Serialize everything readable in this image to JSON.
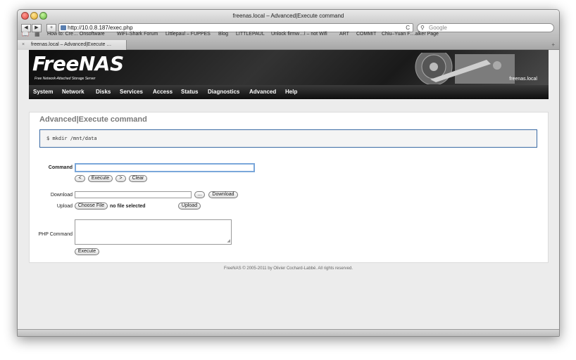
{
  "window": {
    "title": "freenas.local – Advanced|Execute command"
  },
  "toolbar": {
    "back": "◀",
    "forward": "▶",
    "add": "+",
    "url": "http://10.0.8.187/exec.php",
    "reload": "C",
    "search_placeholder": "Google"
  },
  "bookmarks": [
    "How to: Cre… Onsoftware",
    "WiFi–Shark Forum",
    "Littlepaul – FUPPES",
    "Blog",
    "LITTLEPAUL",
    "Unlock firmw…i – not Wifi",
    "ART",
    "COMMIT",
    "Chiu–Yuan F…alker Page"
  ],
  "tab": {
    "label": "freenas.local – Advanced|Execute …",
    "close": "×",
    "add": "+"
  },
  "header": {
    "logo": "FreeNAS",
    "tagline": "Free Network-Attached Storage Server",
    "hostname": "freenas.local"
  },
  "nav": [
    "System",
    "Network",
    "Disks",
    "Services",
    "Access",
    "Status",
    "Diagnostics",
    "Advanced",
    "Help"
  ],
  "main": {
    "title": "Advanced|Execute command",
    "output": "$ mkdir /mnt/data",
    "command_label": "Command",
    "command_value": "",
    "buttons": {
      "prev": "<",
      "execute": "Execute",
      "next": ">",
      "clear": "Clear"
    },
    "download_label": "Download",
    "download_value": "",
    "browse": "...",
    "download_button": "Download",
    "upload_label": "Upload",
    "choose_file": "Choose File",
    "no_file": "no file selected",
    "upload_button": "Upload",
    "php_label": "PHP Command",
    "php_value": "",
    "php_execute": "Execute"
  },
  "footer": "FreeNAS © 2005-2011 by Olivier Cochard-Labbé. All rights reserved.",
  "colors": {
    "header_bg": "#1a1a1a",
    "nav_bg": "#1e1e1e",
    "title_gray": "#7a7a7a",
    "output_border": "#3a6aa4"
  }
}
